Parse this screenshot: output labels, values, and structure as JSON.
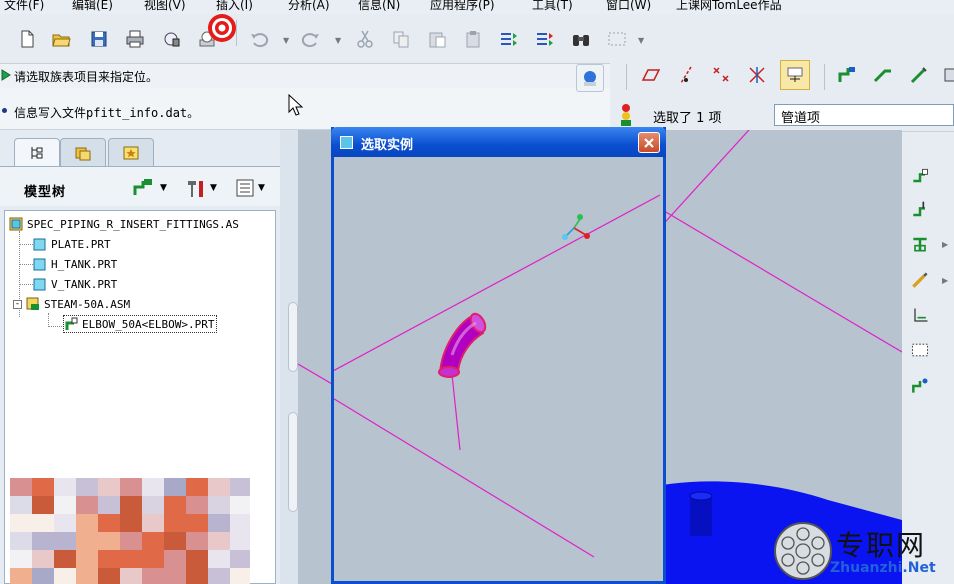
{
  "menubar": {
    "items": [
      "文件(F)",
      "编辑(E)",
      "视图(V)",
      "插入(I)",
      "分析(A)",
      "信息(N)",
      "应用程序(P)",
      "工具(T)",
      "窗口(W)",
      "上课网TomLee作品"
    ]
  },
  "prompt": {
    "text": "请选取族表项目来指定位。"
  },
  "message": {
    "text": "信息写入文件pfitt_info.dat。"
  },
  "selection": {
    "count_text": "选取了 1 项",
    "filter_value": "管道项"
  },
  "left_panel": {
    "title": "模型树",
    "tree": {
      "root": "SPEC_PIPING_R_INSERT_FITTINGS.AS",
      "items": [
        "PLATE.PRT",
        "H_TANK.PRT",
        "V_TANK.PRT",
        "STEAM-50A.ASM",
        "ELBOW_50A<ELBOW>.PRT"
      ]
    }
  },
  "dialog": {
    "title": "选取实例"
  },
  "watermark": {
    "text": "专职网",
    "domain": "Zhuanzhi.Net"
  },
  "colors": {
    "dialog_title": "#0a4fd0",
    "curve": "#e020c8",
    "tank": "#0a14f0",
    "elbow": "#b000c0"
  }
}
